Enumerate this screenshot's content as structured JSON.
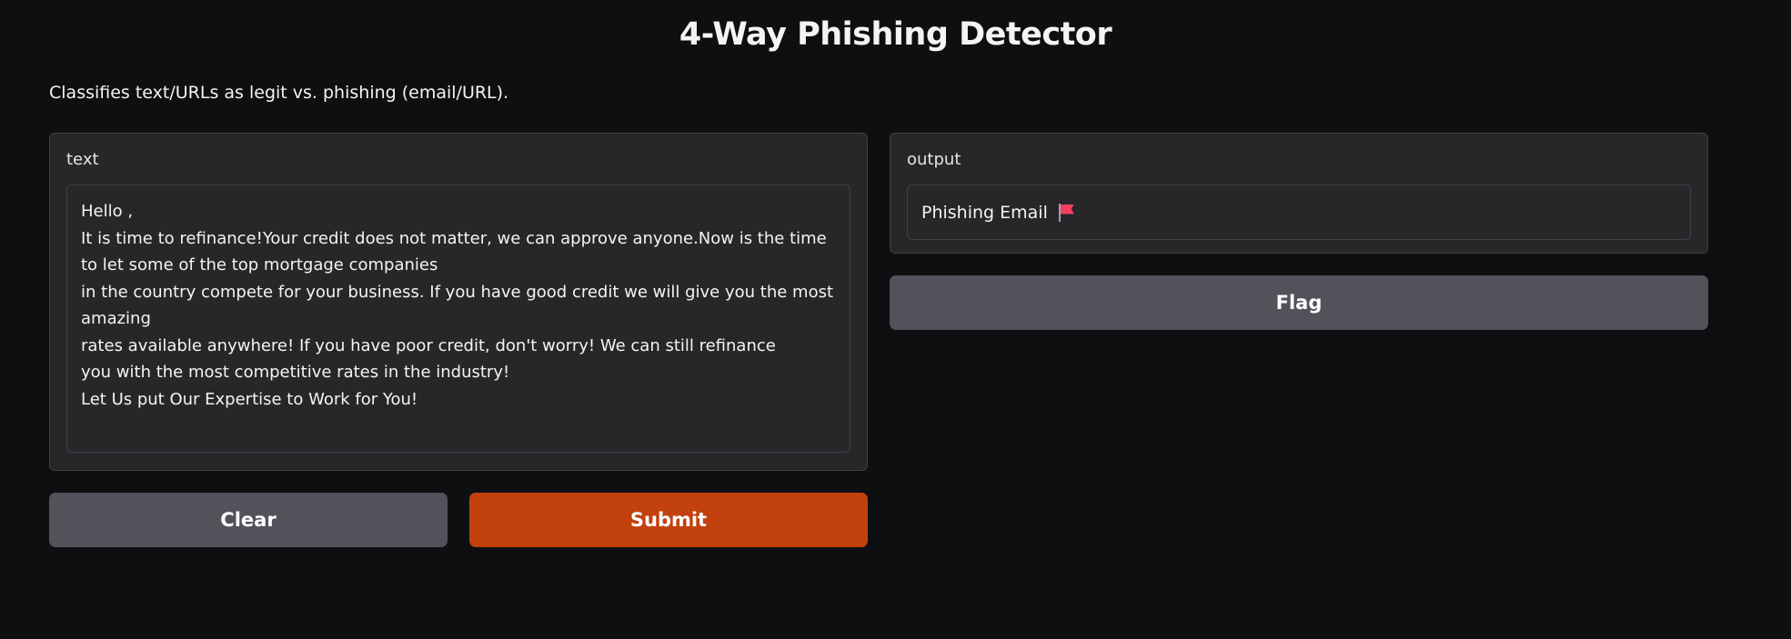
{
  "header": {
    "title": "4-Way Phishing Detector",
    "description": "Classifies text/URLs as legit vs. phishing (email/URL)."
  },
  "input_panel": {
    "label": "text",
    "value": "Hello ,\nIt is time to refinance!Your credit does not matter, we can approve anyone.Now is the time to let some of the top mortgage companies\nin the country compete for your business. If you have good credit we will give you the most amazing\nrates available anywhere! If you have poor credit, don't worry! We can still refinance\nyou with the most competitive rates in the industry!\nLet Us put Our Expertise to Work for You!"
  },
  "buttons": {
    "clear_label": "Clear",
    "submit_label": "Submit",
    "flag_label": "Flag"
  },
  "output_panel": {
    "label": "output",
    "value": "Phishing Email",
    "icon": "red-flag-icon"
  },
  "colors": {
    "background": "#0f0f11",
    "panel": "#27272a",
    "primary_button": "#c2410c",
    "secondary_button": "#52525b"
  }
}
